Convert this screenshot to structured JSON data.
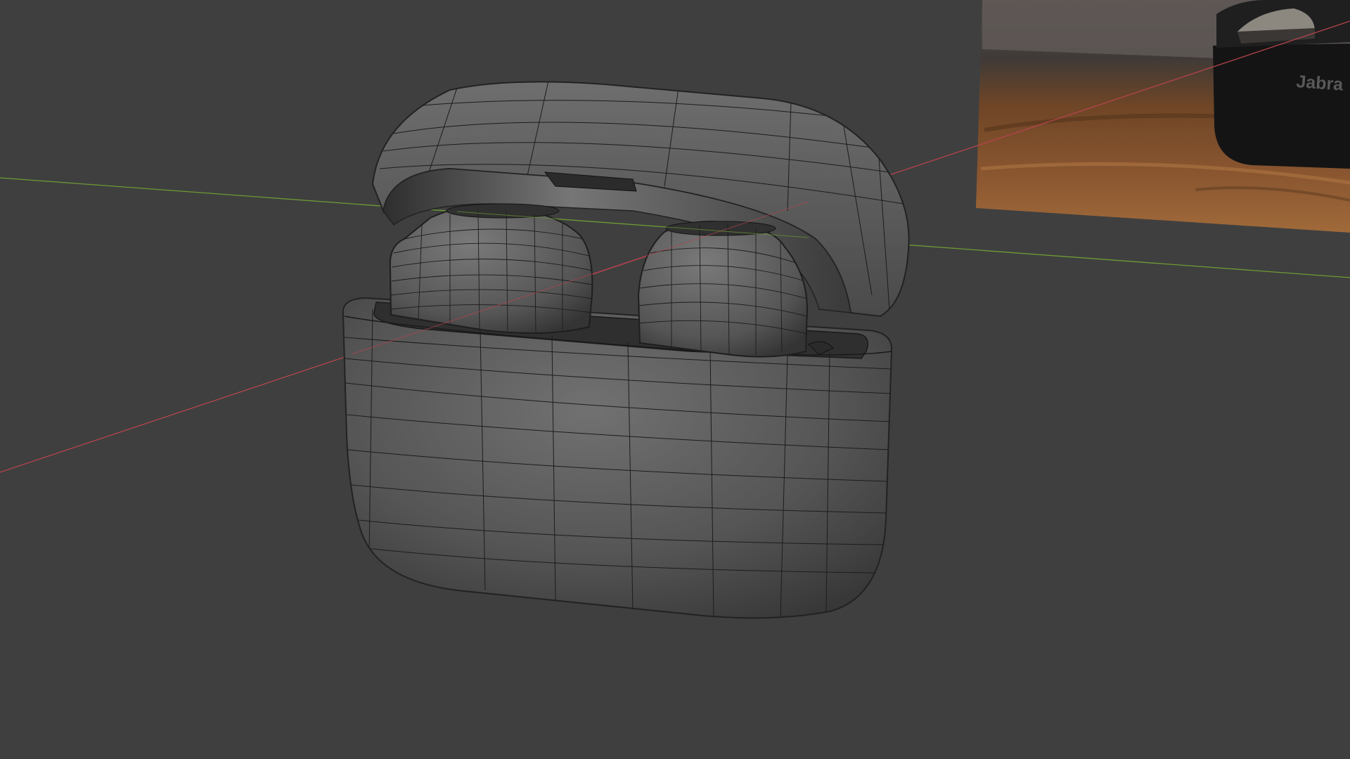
{
  "viewport": {
    "background_color": "#3f3f3f",
    "axis_x_color": "#b5434d",
    "axis_y_color": "#6e9a35",
    "wire_color": "#1c1c1c",
    "shell_light": "#6a6a6a",
    "shell_dark": "#3a3a3a"
  },
  "reference_image": {
    "brand_text": "Jabra",
    "wood_color": "#7a4a25",
    "case_color": "#151515"
  },
  "objects": [
    {
      "name": "case-lid",
      "icon": "mesh-object-icon"
    },
    {
      "name": "case-body",
      "icon": "mesh-object-icon"
    },
    {
      "name": "earbud-left",
      "icon": "mesh-object-icon"
    },
    {
      "name": "earbud-right",
      "icon": "mesh-object-icon"
    }
  ]
}
